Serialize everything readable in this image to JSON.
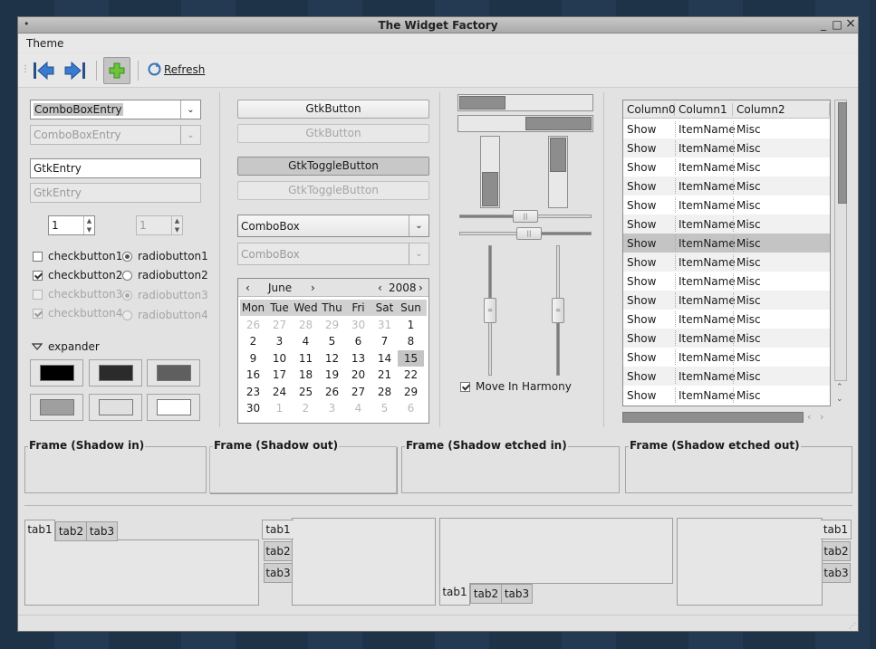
{
  "window": {
    "title": "The Widget Factory",
    "menu_glyph": "•",
    "minimize": "_",
    "maximize": "□",
    "close": "×"
  },
  "menubar": {
    "items": [
      {
        "label": "Theme"
      }
    ]
  },
  "toolbar": {
    "refresh_label": "Refresh",
    "grip": "⋮"
  },
  "col1": {
    "combo_entry": "ComboBoxEntry",
    "combo_entry_disabled": "ComboBoxEntry",
    "entry": "GtkEntry",
    "entry_disabled": "GtkEntry",
    "spin": "1",
    "spin_disabled": "1",
    "checks": [
      {
        "label": "checkbutton1",
        "checked": false,
        "disabled": false
      },
      {
        "label": "checkbutton2",
        "checked": true,
        "disabled": false
      },
      {
        "label": "checkbutton3",
        "checked": false,
        "disabled": true
      },
      {
        "label": "checkbutton4",
        "checked": true,
        "disabled": true
      }
    ],
    "radios": [
      {
        "label": "radiobutton1",
        "checked": true,
        "disabled": false
      },
      {
        "label": "radiobutton2",
        "checked": false,
        "disabled": false
      },
      {
        "label": "radiobutton3",
        "checked": true,
        "disabled": true
      },
      {
        "label": "radiobutton4",
        "checked": false,
        "disabled": true
      }
    ],
    "expander": "expander",
    "swatches": [
      "#000000",
      "#2b2b2b",
      "#5f5f5f",
      "#9f9f9f",
      "#e0e0e0",
      "#ffffff"
    ]
  },
  "col2": {
    "button": "GtkButton",
    "button_disabled": "GtkButton",
    "toggle": "GtkToggleButton",
    "toggle_disabled": "GtkToggleButton",
    "combo": "ComboBox",
    "combo_disabled": "ComboBox",
    "calendar": {
      "month": "June",
      "year": "2008",
      "day_names": [
        "Mon",
        "Tue",
        "Wed",
        "Thu",
        "Fri",
        "Sat",
        "Sun"
      ],
      "weeks": [
        [
          "26",
          "27",
          "28",
          "29",
          "30",
          "31",
          "1"
        ],
        [
          "2",
          "3",
          "4",
          "5",
          "6",
          "7",
          "8"
        ],
        [
          "9",
          "10",
          "11",
          "12",
          "13",
          "14",
          "15"
        ],
        [
          "16",
          "17",
          "18",
          "19",
          "20",
          "21",
          "22"
        ],
        [
          "23",
          "24",
          "25",
          "26",
          "27",
          "28",
          "29"
        ],
        [
          "30",
          "1",
          "2",
          "3",
          "4",
          "5",
          "6"
        ]
      ],
      "selected": "15"
    }
  },
  "col3": {
    "progress_h": [
      0.35,
      0.5
    ],
    "progress_v": [
      0.5,
      0.5
    ],
    "hscale_values": [
      0.5,
      0.5
    ],
    "vscale_values": [
      0.5,
      0.5
    ],
    "harmony_label": "Move In Harmony",
    "harmony_checked": true
  },
  "tree": {
    "columns": [
      "Column0",
      "Column1",
      "Column2"
    ],
    "rows": [
      [
        "Show",
        "ItemName",
        "Misc"
      ],
      [
        "Show",
        "ItemName",
        "Misc"
      ],
      [
        "Show",
        "ItemName",
        "Misc"
      ],
      [
        "Show",
        "ItemName",
        "Misc"
      ],
      [
        "Show",
        "ItemName",
        "Misc"
      ],
      [
        "Show",
        "ItemName",
        "Misc"
      ],
      [
        "Show",
        "ItemName",
        "Misc"
      ],
      [
        "Show",
        "ItemName",
        "Misc"
      ],
      [
        "Show",
        "ItemName",
        "Misc"
      ],
      [
        "Show",
        "ItemName",
        "Misc"
      ],
      [
        "Show",
        "ItemName",
        "Misc"
      ],
      [
        "Show",
        "ItemName",
        "Misc"
      ],
      [
        "Show",
        "ItemName",
        "Misc"
      ],
      [
        "Show",
        "ItemName",
        "Misc"
      ],
      [
        "Show",
        "ItemName",
        "Misc"
      ]
    ],
    "selected_row": 6
  },
  "frames": [
    "Frame (Shadow in)",
    "Frame (Shadow out)",
    "Frame (Shadow etched in)",
    "Frame (Shadow etched out)"
  ],
  "notebooks": {
    "tabs": [
      "tab1",
      "tab2",
      "tab3"
    ]
  }
}
